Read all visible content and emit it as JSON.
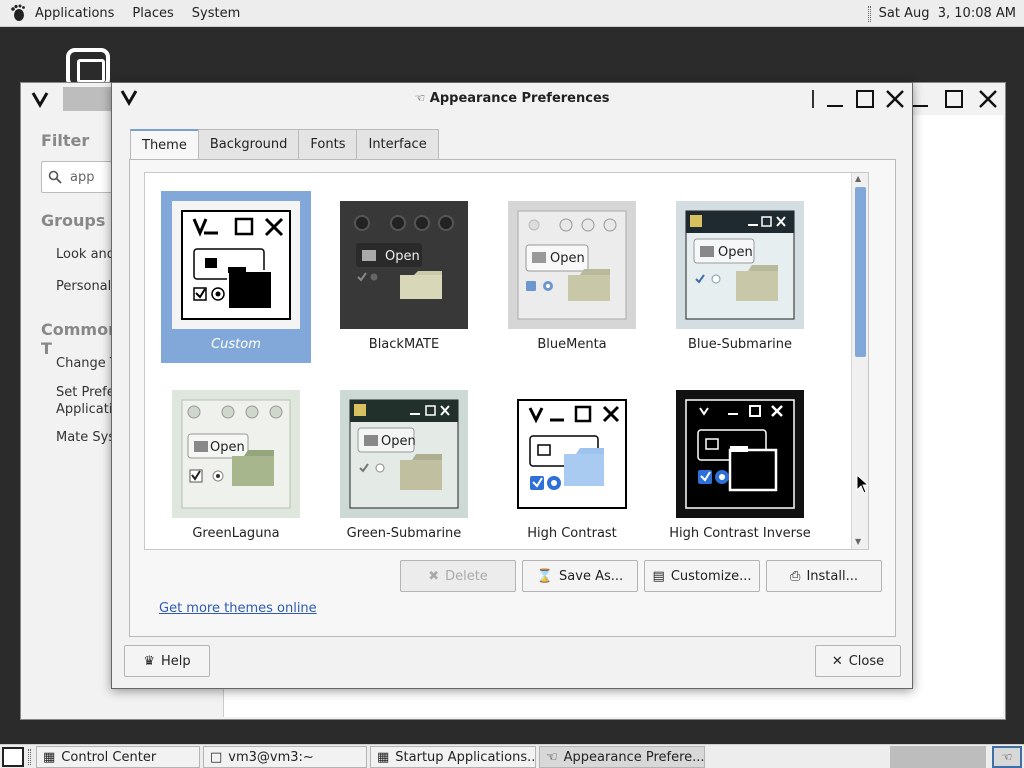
{
  "top_panel": {
    "menus": [
      "Applications",
      "Places",
      "System"
    ],
    "clock": "Sat Aug  3, 10:08 AM"
  },
  "control_center": {
    "filter_heading": "Filter",
    "filter_value": "app",
    "groups_heading": "Groups",
    "groups": [
      "Look and",
      "Personal"
    ],
    "common_heading": "Common T",
    "common": [
      "Change T",
      "Set Prefe",
      "Applicatio",
      "Mate Syst"
    ]
  },
  "dialog": {
    "title": "Appearance Preferences",
    "tabs": [
      "Theme",
      "Background",
      "Fonts",
      "Interface"
    ],
    "active_tab": "Theme",
    "themes": [
      {
        "name": "Custom",
        "selected": true
      },
      {
        "name": "BlackMATE",
        "selected": false
      },
      {
        "name": "BlueMenta",
        "selected": false
      },
      {
        "name": "Blue-Submarine",
        "selected": false
      },
      {
        "name": "GreenLaguna",
        "selected": false
      },
      {
        "name": "Green-Submarine",
        "selected": false
      },
      {
        "name": "High Contrast",
        "selected": false
      },
      {
        "name": "High Contrast Inverse",
        "selected": false
      }
    ],
    "thumb_open_label": "Open",
    "buttons": {
      "delete": "Delete",
      "save_as": "Save As...",
      "customize": "Customize...",
      "install": "Install..."
    },
    "more_link": "Get more themes online",
    "help": "Help",
    "close": "Close"
  },
  "taskbar": {
    "items": [
      {
        "label": "Control Center",
        "active": false
      },
      {
        "label": "vm3@vm3:~",
        "active": false
      },
      {
        "label": "Startup Applications...",
        "active": false
      },
      {
        "label": "Appearance Prefere...",
        "active": true
      }
    ]
  },
  "colors": {
    "selection": "#81a8d8",
    "link": "#2e5bb3",
    "panel": "#ededed",
    "desktop": "#2b2b2b"
  }
}
